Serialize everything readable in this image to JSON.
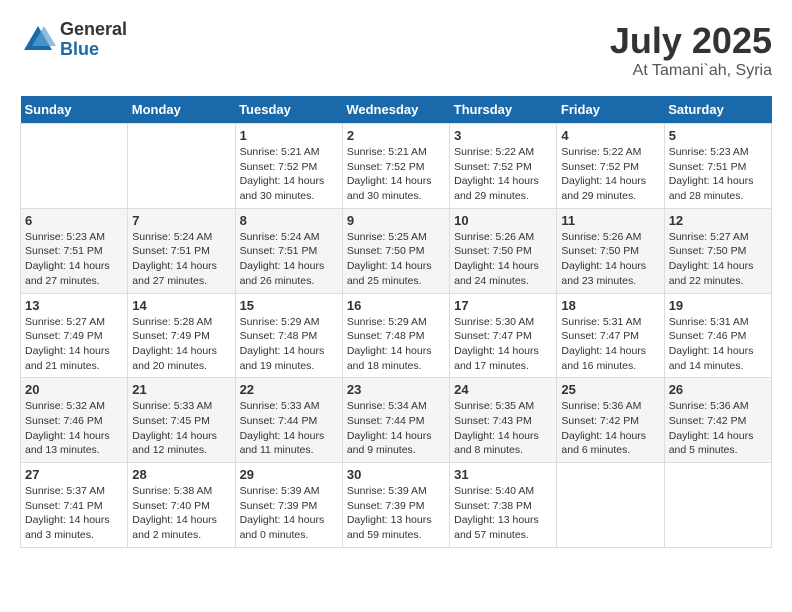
{
  "logo": {
    "general": "General",
    "blue": "Blue"
  },
  "title": {
    "month": "July 2025",
    "location": "At Tamani`ah, Syria"
  },
  "weekdays": [
    "Sunday",
    "Monday",
    "Tuesday",
    "Wednesday",
    "Thursday",
    "Friday",
    "Saturday"
  ],
  "weeks": [
    [
      {
        "day": "",
        "info": ""
      },
      {
        "day": "",
        "info": ""
      },
      {
        "day": "1",
        "info": "Sunrise: 5:21 AM\nSunset: 7:52 PM\nDaylight: 14 hours and 30 minutes."
      },
      {
        "day": "2",
        "info": "Sunrise: 5:21 AM\nSunset: 7:52 PM\nDaylight: 14 hours and 30 minutes."
      },
      {
        "day": "3",
        "info": "Sunrise: 5:22 AM\nSunset: 7:52 PM\nDaylight: 14 hours and 29 minutes."
      },
      {
        "day": "4",
        "info": "Sunrise: 5:22 AM\nSunset: 7:52 PM\nDaylight: 14 hours and 29 minutes."
      },
      {
        "day": "5",
        "info": "Sunrise: 5:23 AM\nSunset: 7:51 PM\nDaylight: 14 hours and 28 minutes."
      }
    ],
    [
      {
        "day": "6",
        "info": "Sunrise: 5:23 AM\nSunset: 7:51 PM\nDaylight: 14 hours and 27 minutes."
      },
      {
        "day": "7",
        "info": "Sunrise: 5:24 AM\nSunset: 7:51 PM\nDaylight: 14 hours and 27 minutes."
      },
      {
        "day": "8",
        "info": "Sunrise: 5:24 AM\nSunset: 7:51 PM\nDaylight: 14 hours and 26 minutes."
      },
      {
        "day": "9",
        "info": "Sunrise: 5:25 AM\nSunset: 7:50 PM\nDaylight: 14 hours and 25 minutes."
      },
      {
        "day": "10",
        "info": "Sunrise: 5:26 AM\nSunset: 7:50 PM\nDaylight: 14 hours and 24 minutes."
      },
      {
        "day": "11",
        "info": "Sunrise: 5:26 AM\nSunset: 7:50 PM\nDaylight: 14 hours and 23 minutes."
      },
      {
        "day": "12",
        "info": "Sunrise: 5:27 AM\nSunset: 7:50 PM\nDaylight: 14 hours and 22 minutes."
      }
    ],
    [
      {
        "day": "13",
        "info": "Sunrise: 5:27 AM\nSunset: 7:49 PM\nDaylight: 14 hours and 21 minutes."
      },
      {
        "day": "14",
        "info": "Sunrise: 5:28 AM\nSunset: 7:49 PM\nDaylight: 14 hours and 20 minutes."
      },
      {
        "day": "15",
        "info": "Sunrise: 5:29 AM\nSunset: 7:48 PM\nDaylight: 14 hours and 19 minutes."
      },
      {
        "day": "16",
        "info": "Sunrise: 5:29 AM\nSunset: 7:48 PM\nDaylight: 14 hours and 18 minutes."
      },
      {
        "day": "17",
        "info": "Sunrise: 5:30 AM\nSunset: 7:47 PM\nDaylight: 14 hours and 17 minutes."
      },
      {
        "day": "18",
        "info": "Sunrise: 5:31 AM\nSunset: 7:47 PM\nDaylight: 14 hours and 16 minutes."
      },
      {
        "day": "19",
        "info": "Sunrise: 5:31 AM\nSunset: 7:46 PM\nDaylight: 14 hours and 14 minutes."
      }
    ],
    [
      {
        "day": "20",
        "info": "Sunrise: 5:32 AM\nSunset: 7:46 PM\nDaylight: 14 hours and 13 minutes."
      },
      {
        "day": "21",
        "info": "Sunrise: 5:33 AM\nSunset: 7:45 PM\nDaylight: 14 hours and 12 minutes."
      },
      {
        "day": "22",
        "info": "Sunrise: 5:33 AM\nSunset: 7:44 PM\nDaylight: 14 hours and 11 minutes."
      },
      {
        "day": "23",
        "info": "Sunrise: 5:34 AM\nSunset: 7:44 PM\nDaylight: 14 hours and 9 minutes."
      },
      {
        "day": "24",
        "info": "Sunrise: 5:35 AM\nSunset: 7:43 PM\nDaylight: 14 hours and 8 minutes."
      },
      {
        "day": "25",
        "info": "Sunrise: 5:36 AM\nSunset: 7:42 PM\nDaylight: 14 hours and 6 minutes."
      },
      {
        "day": "26",
        "info": "Sunrise: 5:36 AM\nSunset: 7:42 PM\nDaylight: 14 hours and 5 minutes."
      }
    ],
    [
      {
        "day": "27",
        "info": "Sunrise: 5:37 AM\nSunset: 7:41 PM\nDaylight: 14 hours and 3 minutes."
      },
      {
        "day": "28",
        "info": "Sunrise: 5:38 AM\nSunset: 7:40 PM\nDaylight: 14 hours and 2 minutes."
      },
      {
        "day": "29",
        "info": "Sunrise: 5:39 AM\nSunset: 7:39 PM\nDaylight: 14 hours and 0 minutes."
      },
      {
        "day": "30",
        "info": "Sunrise: 5:39 AM\nSunset: 7:39 PM\nDaylight: 13 hours and 59 minutes."
      },
      {
        "day": "31",
        "info": "Sunrise: 5:40 AM\nSunset: 7:38 PM\nDaylight: 13 hours and 57 minutes."
      },
      {
        "day": "",
        "info": ""
      },
      {
        "day": "",
        "info": ""
      }
    ]
  ]
}
